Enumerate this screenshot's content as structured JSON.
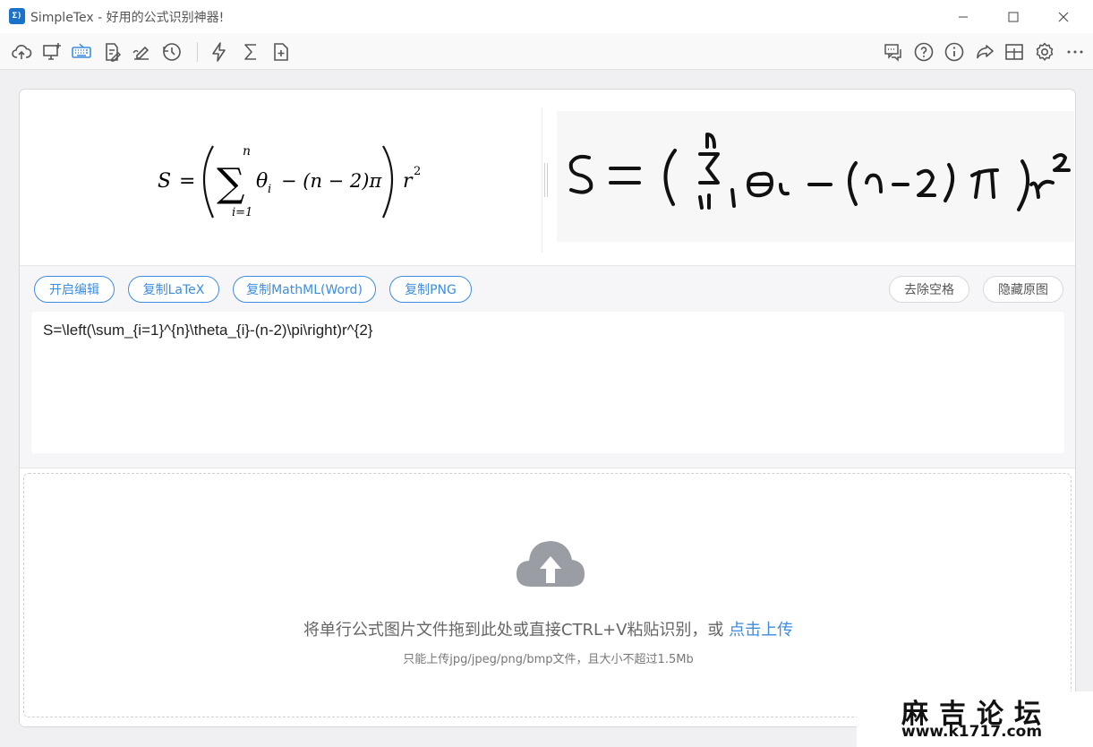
{
  "window": {
    "title": "SimpleTex - 好用的公式识别神器!",
    "logo_text": "Σ)"
  },
  "toolbar": {
    "left_icons": [
      "upload-cloud-icon",
      "screenshot-icon",
      "keyboard-icon",
      "edit-doc-icon",
      "handwrite-icon",
      "history-icon",
      "flash-icon",
      "sigma-icon",
      "new-file-icon"
    ],
    "right_icons": [
      "feedback-icon",
      "help-icon",
      "info-icon",
      "share-icon",
      "window-icon",
      "settings-icon",
      "more-icon"
    ]
  },
  "preview": {
    "rendered_formula": {
      "lhs": "S",
      "equals": "=",
      "sum_upper": "n",
      "sum_lower": "i=1",
      "body": "θ",
      "sub": "i",
      "rest": "− (n − 2)π",
      "tail": "r",
      "exp": "2"
    },
    "handwritten": "S = ( Σ θi − (n−2) π ) r²"
  },
  "actions": {
    "edit": "开启编辑",
    "copy_latex": "复制LaTeX",
    "copy_mathml": "复制MathML(Word)",
    "copy_png": "复制PNG",
    "remove_spaces": "去除空格",
    "hide_original": "隐藏原图"
  },
  "latex": {
    "value": "S=\\left(\\sum_{i=1}^{n}\\theta_{i}-(n-2)\\pi\\right)r^{2}"
  },
  "upload": {
    "main_text": "将单行公式图片文件拖到此处或直接CTRL+V粘贴识别，或 ",
    "link_text": "点击上传",
    "hint": "只能上传jpg/jpeg/png/bmp文件，且大小不超过1.5Mb"
  },
  "watermark": {
    "name": "麻吉论坛",
    "url": "www.k1717.com"
  },
  "colors": {
    "accent": "#3d8de0",
    "icon": "#555555",
    "keyboard_active": "#3d8de0"
  }
}
